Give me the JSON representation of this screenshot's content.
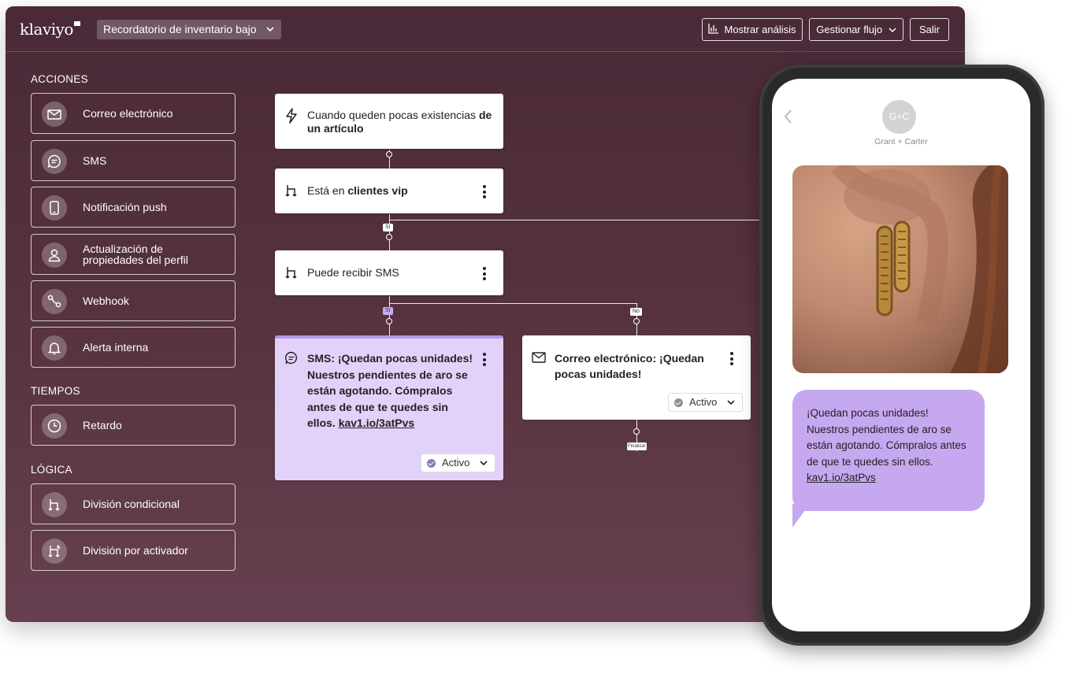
{
  "app": {
    "logo": "klaviyo",
    "flow_selector": "Recordatorio de inventario bajo",
    "buttons": {
      "analytics": "Mostrar análisis",
      "manage_flow": "Gestionar flujo",
      "exit": "Salir"
    }
  },
  "sidebar": {
    "actions_heading": "ACCIONES",
    "actions": [
      {
        "label": "Correo electrónico",
        "icon": "mail-icon"
      },
      {
        "label": "SMS",
        "icon": "sms-icon"
      },
      {
        "label": "Notificación push",
        "icon": "phone-icon"
      },
      {
        "label_line1": "Actualización de",
        "label_line2": "propiedades del perfil",
        "icon": "user-icon"
      },
      {
        "label": "Webhook",
        "icon": "webhook-icon"
      },
      {
        "label": "Alerta interna",
        "icon": "bell-icon"
      }
    ],
    "timing_heading": "TIEMPOS",
    "timing": [
      {
        "label": "Retardo",
        "icon": "clock-icon"
      }
    ],
    "logic_heading": "LÓGICA",
    "logic": [
      {
        "label": "División condicional",
        "icon": "split-icon"
      },
      {
        "label": "División por activador",
        "icon": "trigger-split-icon"
      }
    ]
  },
  "flow": {
    "trigger": {
      "text_plain": "Cuando queden pocas existencias ",
      "text_bold_1": "de",
      "text_bold_2": "un artículo"
    },
    "condition1": {
      "text_plain": "Está en ",
      "text_bold": "clientes vip"
    },
    "yes_label": "Sí",
    "condition2": {
      "text": "Puede recibir SMS"
    },
    "no_label": "No",
    "sms_node": {
      "lines": [
        "SMS: ¡Quedan pocas unidades!",
        "Nuestros pendientes de aro se",
        "están agotando. Cómpralos",
        "antes de que te quedes sin"
      ],
      "last_plain": "ellos. ",
      "link": "kav1.io/3atPvs",
      "status": "Activo"
    },
    "email_node": {
      "lines": [
        "Correo electrónico: ¡Quedan",
        "pocas unidades!"
      ],
      "status": "Activo"
    },
    "end_label": "Finalizar"
  },
  "phone": {
    "avatar": "G+C",
    "sender": "Grant + Carter",
    "message_lines": [
      "¡Quedan pocas unidades!",
      "Nuestros pendientes de aro se",
      "están agotando. Cómpralos antes",
      "de que te quedes sin ellos."
    ],
    "message_link": "kav1.io/3atPvs"
  },
  "colors": {
    "bg_dark": "#4a2a38",
    "accent_purple": "#c6a8f0",
    "sms_node_bg": "#e2d2fa"
  }
}
